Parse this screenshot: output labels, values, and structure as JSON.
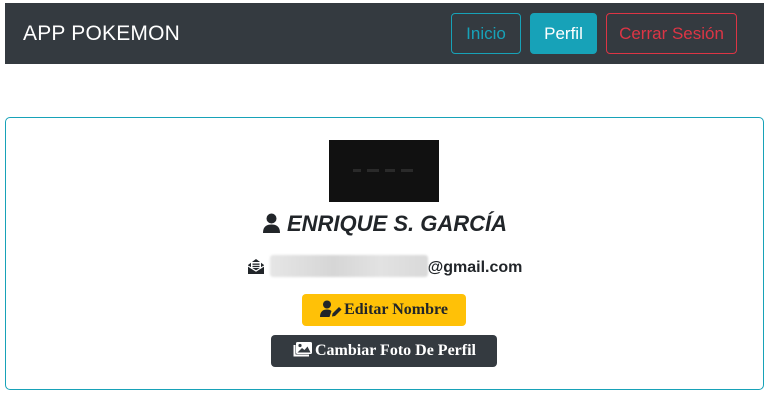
{
  "navbar": {
    "brand": "APP POKEMON",
    "links": {
      "inicio": "Inicio",
      "perfil": "Perfil",
      "cerrar_sesion": "Cerrar Sesión"
    }
  },
  "profile": {
    "photo_icon": "profile-photo",
    "name_icon": "user-icon",
    "name": "ENRIQUE S. GARCÍA",
    "email_icon": "envelope-open-icon",
    "email_visible_suffix": "@gmail.com",
    "buttons": {
      "edit_name": "Editar Nombre",
      "edit_name_icon": "user-edit-icon",
      "change_photo": "Cambiar Foto De Perfil",
      "change_photo_icon": "images-icon"
    }
  },
  "colors": {
    "navbar_bg": "#343a40",
    "info": "#17a2b8",
    "danger": "#dc3545",
    "warning": "#ffc107",
    "dark": "#343a40"
  }
}
